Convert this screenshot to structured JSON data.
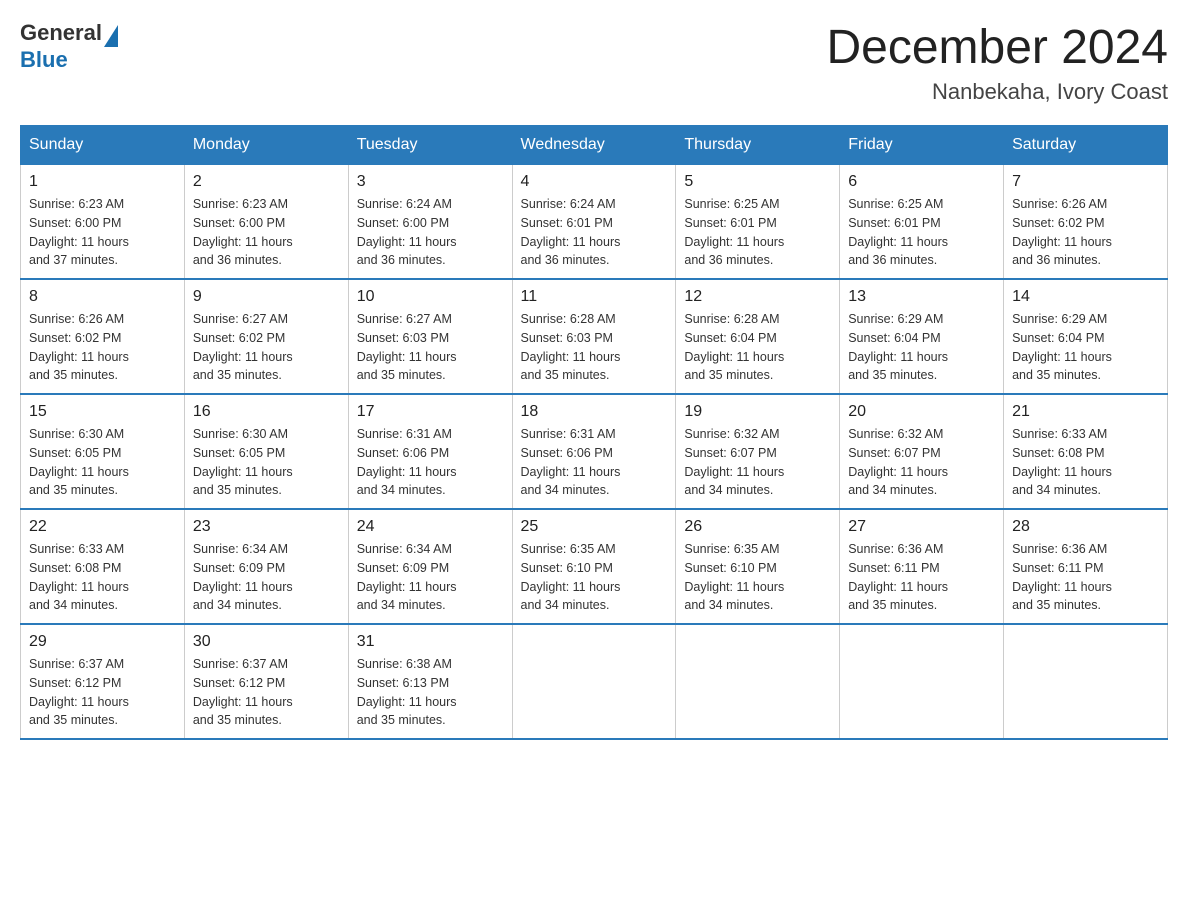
{
  "header": {
    "logo_general": "General",
    "logo_blue": "Blue",
    "month_title": "December 2024",
    "location": "Nanbekaha, Ivory Coast"
  },
  "columns": [
    "Sunday",
    "Monday",
    "Tuesday",
    "Wednesday",
    "Thursday",
    "Friday",
    "Saturday"
  ],
  "weeks": [
    [
      {
        "day": "1",
        "sunrise": "6:23 AM",
        "sunset": "6:00 PM",
        "daylight": "11 hours and 37 minutes."
      },
      {
        "day": "2",
        "sunrise": "6:23 AM",
        "sunset": "6:00 PM",
        "daylight": "11 hours and 36 minutes."
      },
      {
        "day": "3",
        "sunrise": "6:24 AM",
        "sunset": "6:00 PM",
        "daylight": "11 hours and 36 minutes."
      },
      {
        "day": "4",
        "sunrise": "6:24 AM",
        "sunset": "6:01 PM",
        "daylight": "11 hours and 36 minutes."
      },
      {
        "day": "5",
        "sunrise": "6:25 AM",
        "sunset": "6:01 PM",
        "daylight": "11 hours and 36 minutes."
      },
      {
        "day": "6",
        "sunrise": "6:25 AM",
        "sunset": "6:01 PM",
        "daylight": "11 hours and 36 minutes."
      },
      {
        "day": "7",
        "sunrise": "6:26 AM",
        "sunset": "6:02 PM",
        "daylight": "11 hours and 36 minutes."
      }
    ],
    [
      {
        "day": "8",
        "sunrise": "6:26 AM",
        "sunset": "6:02 PM",
        "daylight": "11 hours and 35 minutes."
      },
      {
        "day": "9",
        "sunrise": "6:27 AM",
        "sunset": "6:02 PM",
        "daylight": "11 hours and 35 minutes."
      },
      {
        "day": "10",
        "sunrise": "6:27 AM",
        "sunset": "6:03 PM",
        "daylight": "11 hours and 35 minutes."
      },
      {
        "day": "11",
        "sunrise": "6:28 AM",
        "sunset": "6:03 PM",
        "daylight": "11 hours and 35 minutes."
      },
      {
        "day": "12",
        "sunrise": "6:28 AM",
        "sunset": "6:04 PM",
        "daylight": "11 hours and 35 minutes."
      },
      {
        "day": "13",
        "sunrise": "6:29 AM",
        "sunset": "6:04 PM",
        "daylight": "11 hours and 35 minutes."
      },
      {
        "day": "14",
        "sunrise": "6:29 AM",
        "sunset": "6:04 PM",
        "daylight": "11 hours and 35 minutes."
      }
    ],
    [
      {
        "day": "15",
        "sunrise": "6:30 AM",
        "sunset": "6:05 PM",
        "daylight": "11 hours and 35 minutes."
      },
      {
        "day": "16",
        "sunrise": "6:30 AM",
        "sunset": "6:05 PM",
        "daylight": "11 hours and 35 minutes."
      },
      {
        "day": "17",
        "sunrise": "6:31 AM",
        "sunset": "6:06 PM",
        "daylight": "11 hours and 34 minutes."
      },
      {
        "day": "18",
        "sunrise": "6:31 AM",
        "sunset": "6:06 PM",
        "daylight": "11 hours and 34 minutes."
      },
      {
        "day": "19",
        "sunrise": "6:32 AM",
        "sunset": "6:07 PM",
        "daylight": "11 hours and 34 minutes."
      },
      {
        "day": "20",
        "sunrise": "6:32 AM",
        "sunset": "6:07 PM",
        "daylight": "11 hours and 34 minutes."
      },
      {
        "day": "21",
        "sunrise": "6:33 AM",
        "sunset": "6:08 PM",
        "daylight": "11 hours and 34 minutes."
      }
    ],
    [
      {
        "day": "22",
        "sunrise": "6:33 AM",
        "sunset": "6:08 PM",
        "daylight": "11 hours and 34 minutes."
      },
      {
        "day": "23",
        "sunrise": "6:34 AM",
        "sunset": "6:09 PM",
        "daylight": "11 hours and 34 minutes."
      },
      {
        "day": "24",
        "sunrise": "6:34 AM",
        "sunset": "6:09 PM",
        "daylight": "11 hours and 34 minutes."
      },
      {
        "day": "25",
        "sunrise": "6:35 AM",
        "sunset": "6:10 PM",
        "daylight": "11 hours and 34 minutes."
      },
      {
        "day": "26",
        "sunrise": "6:35 AM",
        "sunset": "6:10 PM",
        "daylight": "11 hours and 34 minutes."
      },
      {
        "day": "27",
        "sunrise": "6:36 AM",
        "sunset": "6:11 PM",
        "daylight": "11 hours and 35 minutes."
      },
      {
        "day": "28",
        "sunrise": "6:36 AM",
        "sunset": "6:11 PM",
        "daylight": "11 hours and 35 minutes."
      }
    ],
    [
      {
        "day": "29",
        "sunrise": "6:37 AM",
        "sunset": "6:12 PM",
        "daylight": "11 hours and 35 minutes."
      },
      {
        "day": "30",
        "sunrise": "6:37 AM",
        "sunset": "6:12 PM",
        "daylight": "11 hours and 35 minutes."
      },
      {
        "day": "31",
        "sunrise": "6:38 AM",
        "sunset": "6:13 PM",
        "daylight": "11 hours and 35 minutes."
      },
      {
        "day": "",
        "sunrise": "",
        "sunset": "",
        "daylight": ""
      },
      {
        "day": "",
        "sunrise": "",
        "sunset": "",
        "daylight": ""
      },
      {
        "day": "",
        "sunrise": "",
        "sunset": "",
        "daylight": ""
      },
      {
        "day": "",
        "sunrise": "",
        "sunset": "",
        "daylight": ""
      }
    ]
  ],
  "labels": {
    "sunrise": "Sunrise:",
    "sunset": "Sunset:",
    "daylight": "Daylight:"
  }
}
